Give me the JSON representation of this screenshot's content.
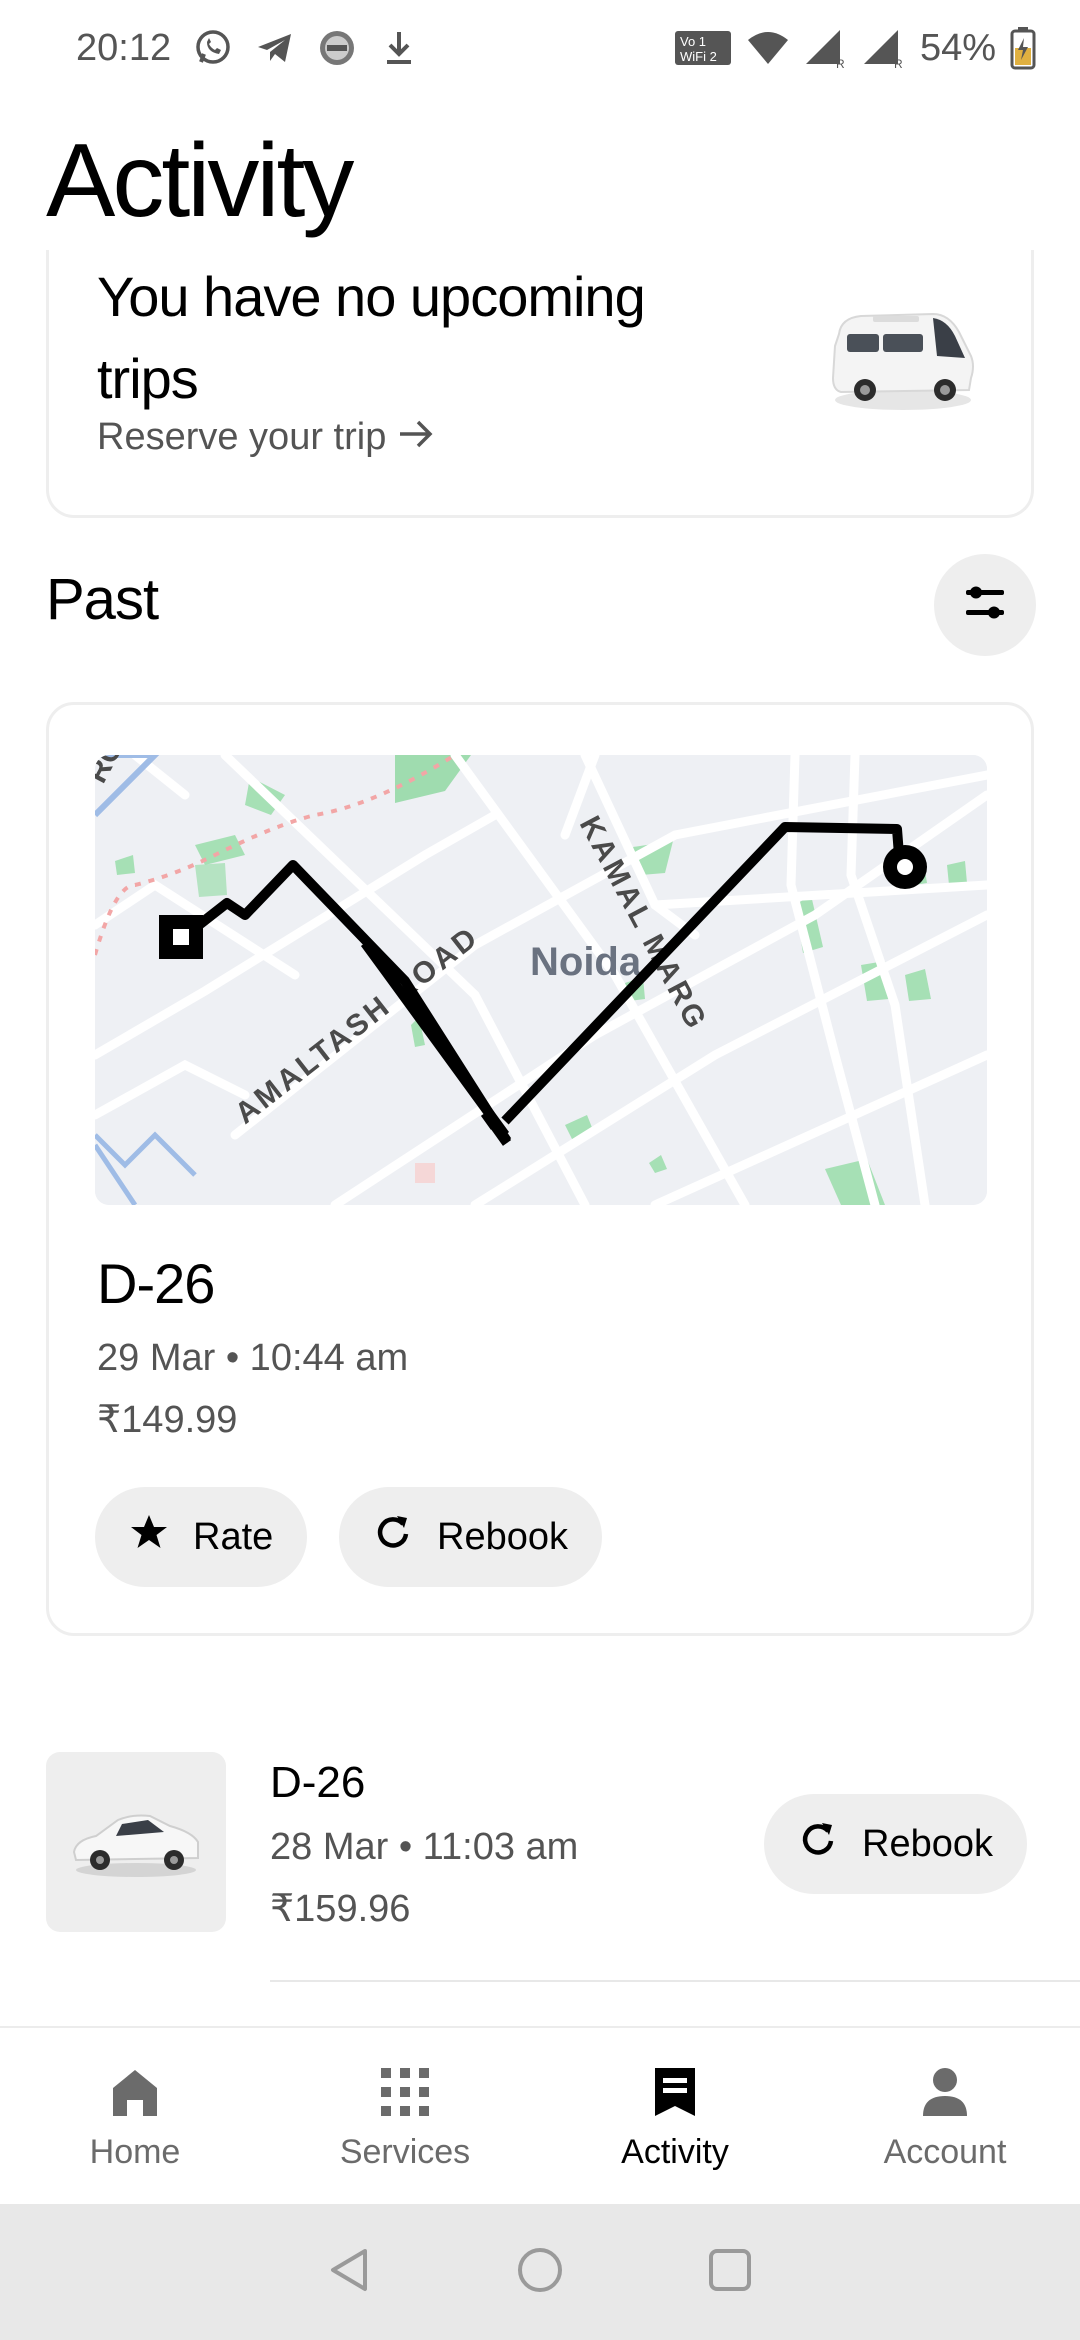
{
  "status_bar": {
    "time": "20:12",
    "battery_pct": "54%",
    "notification_icons": [
      "whatsapp-icon",
      "telegram-icon",
      "app-badge-icon",
      "download-icon"
    ],
    "system_icons": [
      "vowifi-icon",
      "wifi-icon",
      "signal-icon",
      "signal-icon",
      "battery-charging-icon"
    ]
  },
  "page": {
    "title": "Activity"
  },
  "upcoming": {
    "heading": "You have no upcoming trips",
    "reserve_label": "Reserve your trip"
  },
  "past": {
    "heading": "Past",
    "filter_icon": "filter-sliders-icon"
  },
  "map": {
    "labels": {
      "road1": "AMALTASH ROAD",
      "road2": "KAMAL MARG",
      "area": "Noida",
      "corner": "RO"
    }
  },
  "trip_card": {
    "title": "D-26",
    "date": "29 Mar • 10:44 am",
    "price": "₹149.99",
    "rate_label": "Rate",
    "rebook_label": "Rebook"
  },
  "trip_row": {
    "title": "D-26",
    "date": "28 Mar • 11:03 am",
    "price": "₹159.96",
    "rebook_label": "Rebook"
  },
  "bottom_nav": {
    "items": [
      {
        "label": "Home",
        "icon": "home-icon"
      },
      {
        "label": "Services",
        "icon": "grid-icon"
      },
      {
        "label": "Activity",
        "icon": "receipt-icon",
        "active": true
      },
      {
        "label": "Account",
        "icon": "person-icon"
      }
    ]
  },
  "colors": {
    "pill_bg": "#eeeeee",
    "map_bg": "#eef0f4",
    "route": "#000000",
    "park": "#9fdcaf"
  }
}
